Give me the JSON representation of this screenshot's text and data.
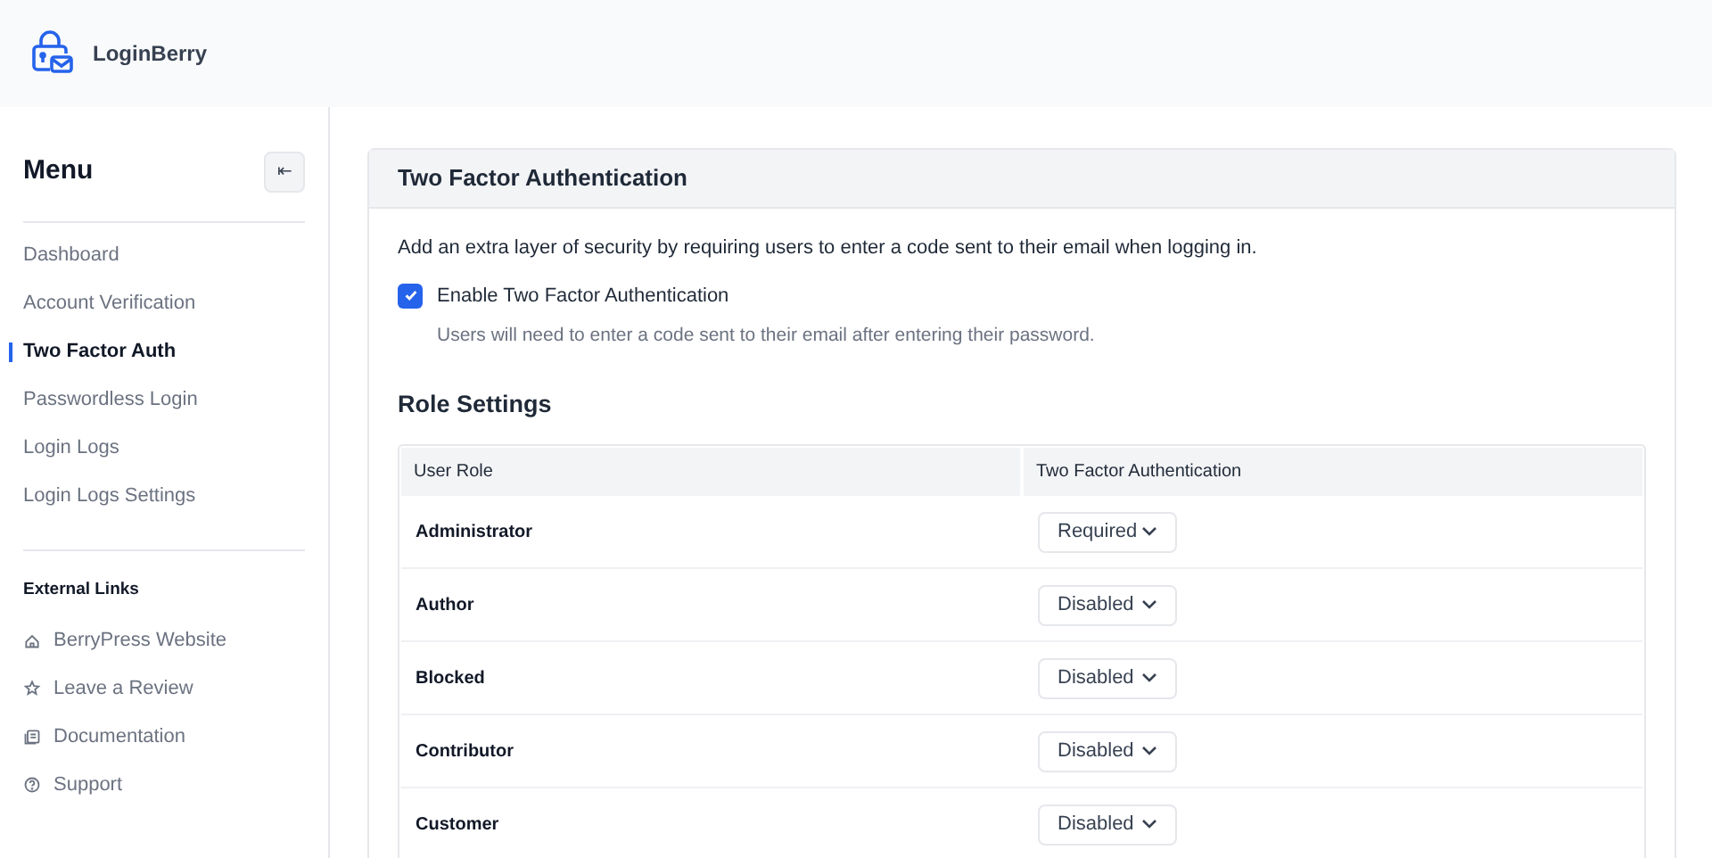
{
  "header": {
    "brand": "LoginBerry"
  },
  "sidebar": {
    "title": "Menu",
    "collapse_button": "⇤",
    "items": [
      {
        "label": "Dashboard",
        "selected": false
      },
      {
        "label": "Account Verification",
        "selected": false
      },
      {
        "label": "Two Factor Auth",
        "selected": true
      },
      {
        "label": "Passwordless Login",
        "selected": false
      },
      {
        "label": "Login Logs",
        "selected": false
      },
      {
        "label": "Login Logs Settings",
        "selected": false
      }
    ],
    "external_links_title": "External Links",
    "external_links": [
      {
        "label": "BerryPress Website",
        "kind": "home"
      },
      {
        "label": "Leave a Review",
        "kind": "star"
      },
      {
        "label": "Documentation",
        "kind": "docs"
      },
      {
        "label": "Support",
        "kind": "help"
      }
    ]
  },
  "panel": {
    "title": "Two Factor Authentication",
    "description": "Add an extra layer of security by requiring users to enter a code sent to their email when logging in.",
    "enable_checkbox": {
      "label": "Enable Two Factor Authentication",
      "checked": true,
      "hint": "Users will need to enter a code sent to their email after entering their password."
    },
    "role_settings_title": "Role Settings",
    "table": {
      "columns": [
        "User Role",
        "Two Factor Authentication"
      ],
      "rows": [
        {
          "role": "Administrator",
          "setting": "Required"
        },
        {
          "role": "Author",
          "setting": "Disabled"
        },
        {
          "role": "Blocked",
          "setting": "Disabled"
        },
        {
          "role": "Contributor",
          "setting": "Disabled"
        },
        {
          "role": "Customer",
          "setting": "Disabled"
        }
      ]
    }
  }
}
